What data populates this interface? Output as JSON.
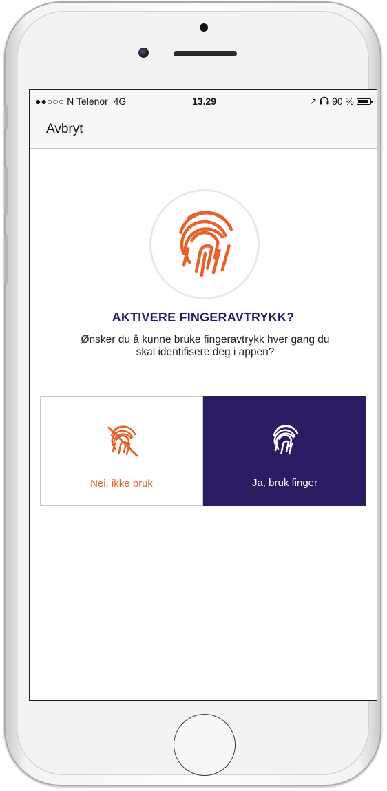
{
  "status_bar": {
    "signal": "●●○○○",
    "carrier": "N Telenor",
    "network": "4G",
    "time": "13.29",
    "location_icon": "↗",
    "headphones_icon": "headphones",
    "battery_percent": "90 %",
    "battery_level": 0.9
  },
  "nav": {
    "cancel_label": "Avbryt"
  },
  "hero": {
    "icon": "fingerprint-icon",
    "title": "AKTIVERE FINGERAVTRYKK?",
    "description": "Ønsker du å kunne bruke fingeravtrykk hver gang du skal identifisere deg i appen?"
  },
  "choices": {
    "no_label": "Nei, ikke bruk",
    "yes_label": "Ja, bruk finger"
  },
  "colors": {
    "accent_orange": "#e8622d",
    "brand_purple": "#2a1b63",
    "title_purple": "#2a1c6a"
  }
}
